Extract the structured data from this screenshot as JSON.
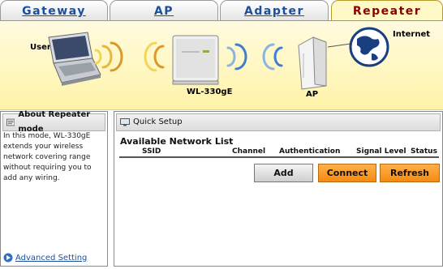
{
  "tabs": [
    {
      "label": "Gateway"
    },
    {
      "label": "AP"
    },
    {
      "label": "Adapter"
    },
    {
      "label": "Repeater"
    }
  ],
  "banner": {
    "user_label": "User",
    "device_label": "WL-330gE",
    "ap_label": "AP",
    "internet_label": "Internet"
  },
  "about": {
    "title": "About Repeater mode",
    "description": "In this mode, WL-330gE extends your wireless network covering range without requiring you to add any wiring.",
    "advanced_link": "Advanced Setting"
  },
  "quick_setup": {
    "title": "Quick Setup",
    "list_title": "Available Network List",
    "columns": [
      "SSID",
      "Channel",
      "Authentication",
      "Signal Level",
      "Status"
    ],
    "rows": [],
    "buttons": {
      "add": "Add",
      "connect": "Connect",
      "refresh": "Refresh"
    }
  },
  "colors": {
    "active_tab_text": "#8b0000",
    "tab_text": "#1a4f9c",
    "banner_bg": "#fff3a8",
    "connect_button": "#f58a10",
    "refresh_button": "#f58a10"
  }
}
